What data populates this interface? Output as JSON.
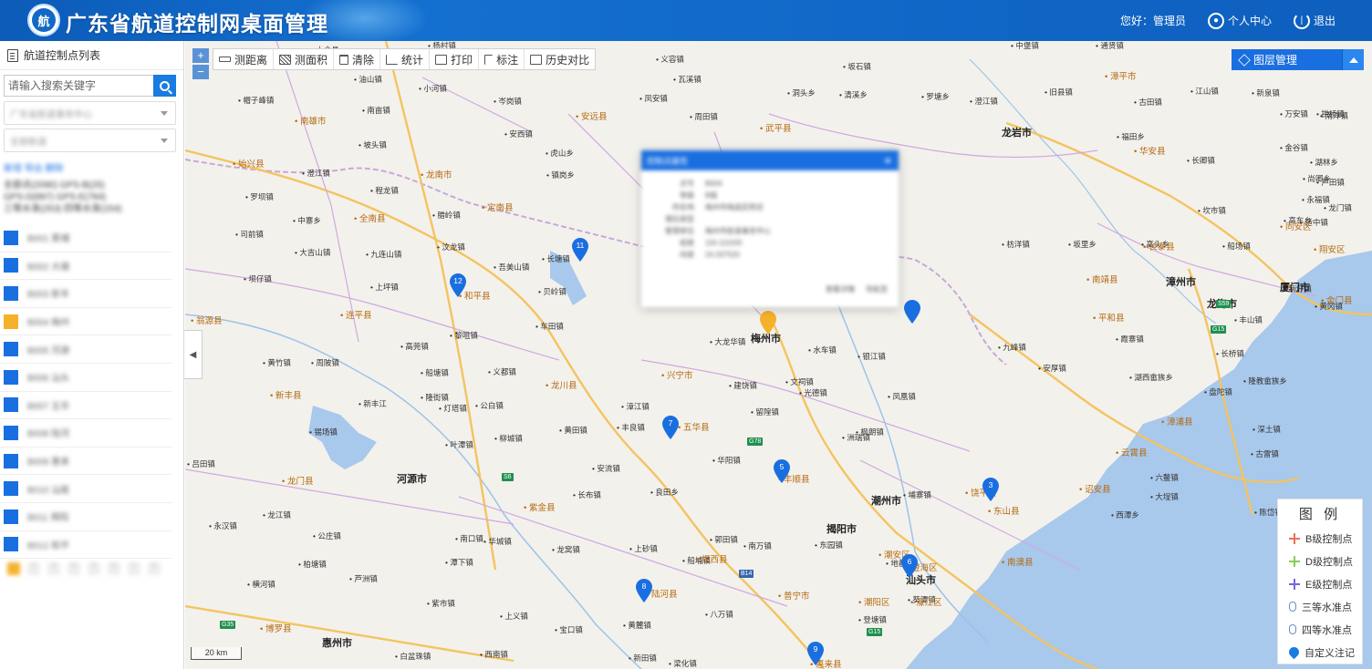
{
  "header": {
    "logo_char": "航",
    "title": "广东省航道控制网桌面管理",
    "greeting": "您好：管理员",
    "personal_center": "个人中心",
    "logout": "退出"
  },
  "sidebar": {
    "title": "航道控制点列表",
    "search_placeholder": "请输入搜索关键字",
    "select_org": "广东省航道事务中心",
    "select_channel": "全部航道",
    "links": "新增  导出  删除",
    "info": [
      "全部点(2090)  GPS-B(25)",
      "GPS-D(897)  GPS-E(784)",
      "三等水准(253)  四等水准(154)"
    ],
    "items": [
      "B001 黄埔",
      "B002 大塘",
      "B003 新丰",
      "B004 梅州",
      "B005 河源",
      "B006 汕头",
      "B007 五华",
      "B008 陆河",
      "B009 惠来",
      "B010 汕尾",
      "B011 揭阳",
      "B012 和平"
    ],
    "pages": [
      "1",
      "2",
      "3",
      "4",
      "5",
      "6",
      "7",
      "8"
    ]
  },
  "toolbar": {
    "zoom_in": "+",
    "zoom_out": "−",
    "buttons": [
      "测距离",
      "测面积",
      "清除",
      "统计",
      "打印",
      "标注",
      "历史对比"
    ],
    "layers": "图层管理"
  },
  "popup": {
    "title": "控制点属性",
    "rows": [
      {
        "k": "点号",
        "v": "B004"
      },
      {
        "k": "等级",
        "v": "B级"
      },
      {
        "k": "所在地",
        "v": "梅州市梅县区附近"
      },
      {
        "k": "埋石类型",
        "v": ""
      },
      {
        "k": "管理单位",
        "v": "梅州市航道事务中心"
      },
      {
        "k": "经度",
        "v": "116.111020"
      },
      {
        "k": "纬度",
        "v": "24.337520"
      }
    ],
    "detail": "查看详情",
    "nav": "导航至"
  },
  "legend": {
    "title": "图 例",
    "items": [
      {
        "label": "B级控制点",
        "color": "#e8735a",
        "icon": "cross-icon"
      },
      {
        "label": "D级控制点",
        "color": "#8fc85c",
        "icon": "cross-icon"
      },
      {
        "label": "E级控制点",
        "color": "#7a64d8",
        "icon": "cross-icon"
      },
      {
        "label": "三等水准点",
        "color": "#6a8bc9",
        "icon": "benchmark-icon"
      },
      {
        "label": "四等水准点",
        "color": "#6a8bc9",
        "icon": "benchmark-icon"
      },
      {
        "label": "自定义注记",
        "color": "#1a7be0",
        "icon": "marker-icon"
      }
    ]
  },
  "pins": [
    "3",
    "5",
    "6",
    "7",
    "8",
    "9",
    "11",
    "12",
    "",
    ""
  ],
  "scale": "20 km",
  "places": {
    "cities": [
      "龙岩市",
      "漳州市",
      "厦门市",
      "河源市",
      "潮州市",
      "揭阳市",
      "汕头市",
      "惠州市",
      "梅州市",
      "龙海市"
    ],
    "counties": [
      "南雄市",
      "始兴县",
      "龙南市",
      "定南县",
      "全南县",
      "和平县",
      "连平县",
      "翁源县",
      "新丰县",
      "龙门县",
      "博罗县",
      "紫金县",
      "龙川县",
      "五华县",
      "兴宁市",
      "丰顺县",
      "揭西县",
      "陆河县",
      "普宁市",
      "惠来县",
      "潮阳区",
      "潮安区",
      "饶平县",
      "南澳县",
      "东山县",
      "诏安县",
      "云霄县",
      "漳浦县",
      "平和县",
      "南靖县",
      "长泰县",
      "华安县",
      "漳平市",
      "武平县",
      "安远县",
      "同安区",
      "翔安区",
      "金门县",
      "澄海区",
      "濠江区"
    ],
    "towns": [
      "大余县",
      "油山镇",
      "帽子峰镇",
      "南亩镇",
      "坡头镇",
      "澄江镇",
      "罗坝镇",
      "程龙镇",
      "中寨乡",
      "司前镇",
      "大吉山镇",
      "九连山镇",
      "坝仔镇",
      "上坪镇",
      "高莞镇",
      "黄竹镇",
      "周陂镇",
      "隆街镇",
      "灯塔镇",
      "船塘镇",
      "义都镇",
      "锡场镇",
      "新丰江",
      "吕田镇",
      "龙江镇",
      "永汉镇",
      "公庄镇",
      "柏塘镇",
      "横河镇",
      "芦洲镇",
      "杨村镇",
      "小河镇",
      "岑岗镇",
      "安西镇",
      "虎山乡",
      "镇岗乡",
      "腊岭镇",
      "汶龙镇",
      "吾美山镇",
      "长塘镇",
      "贝岭镇",
      "车田镇",
      "黎咀镇",
      "公白镇",
      "柳城镇",
      "叶潭镇",
      "黄田镇",
      "紫市镇",
      "上义镇",
      "宝口镇",
      "黄麓镇",
      "新田镇",
      "西南镇",
      "白盆珠镇",
      "梁化镇",
      "八万镇",
      "船埔镇",
      "良田乡",
      "安流镇",
      "长布镇",
      "华阳镇",
      "郭田镇",
      "上砂镇",
      "龙窝镇",
      "南万镇",
      "东园镇",
      "埔寨镇",
      "登塘镇",
      "地都镇",
      "葵潭镇",
      "留隍镇",
      "凤凰镇",
      "文祠镇",
      "建饶镇",
      "光德镇",
      "枫朗镇",
      "洲瑞镇",
      "银江镇",
      "水车镇",
      "大龙华镇",
      "漳江镇",
      "丰良镇",
      "南口镇",
      "华城镇",
      "潭下镇",
      "义容镇",
      "瓦溪镇",
      "凤安镇",
      "周田镇",
      "洞头乡",
      "坂石镇",
      "清溪乡",
      "罗塘乡",
      "澄江镇",
      "中堡镇",
      "通贤镇",
      "旧县镇",
      "古田镇",
      "江山镇",
      "新泉镇",
      "万安镇",
      "南洋镇",
      "拱桥镇",
      "福田乡",
      "长卿镇",
      "金谷镇",
      "湖林乡",
      "尚卿乡",
      "坎市镇",
      "永福镇",
      "芦田镇",
      "龙门镇",
      "适中镇",
      "高车乡",
      "枋洋镇",
      "坂里乡",
      "高头乡",
      "船场镇",
      "丰山镇",
      "霞寨镇",
      "九峰镇",
      "安厚镇",
      "长桥镇",
      "隆教畲族乡",
      "湖西畲族乡",
      "盘陀镇",
      "深土镇",
      "六鳌镇",
      "古雷镇",
      "西潭乡",
      "大埕镇",
      "陈岱镇",
      "黄冈镇",
      "新圩镇",
      "程溪镇",
      "石码镇"
    ]
  }
}
